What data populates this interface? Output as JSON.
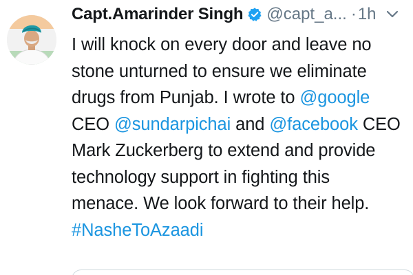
{
  "tweet": {
    "author": {
      "display_name": "Capt.Amarinder Singh",
      "handle": "@capt_a...",
      "verified": true,
      "avatar_icon": "profile-avatar"
    },
    "separator": "·",
    "time": "1h",
    "menu_icon": "chevron-down-icon",
    "text": {
      "line1": "I will knock on every door and leave no",
      "line2": "stone unturned to ensure we eliminate",
      "line3_a": "drugs from Punjab. I wrote to ",
      "line3_mention": "@google",
      "line4_a": "CEO ",
      "line4_mention1": "@sundarpichai",
      "line4_b": " and ",
      "line4_mention2": "@facebook",
      "line4_c": " CEO",
      "line5": "Mark Zuckerberg to extend and provide",
      "line6": "technology support in fighting this",
      "line7": "menace. We look forward to their help.",
      "hashtag": "#NasheToAzaadi"
    },
    "colors": {
      "link": "#1b95e0",
      "muted": "#657786",
      "verified": "#1da1f2",
      "text": "#14171a"
    }
  }
}
